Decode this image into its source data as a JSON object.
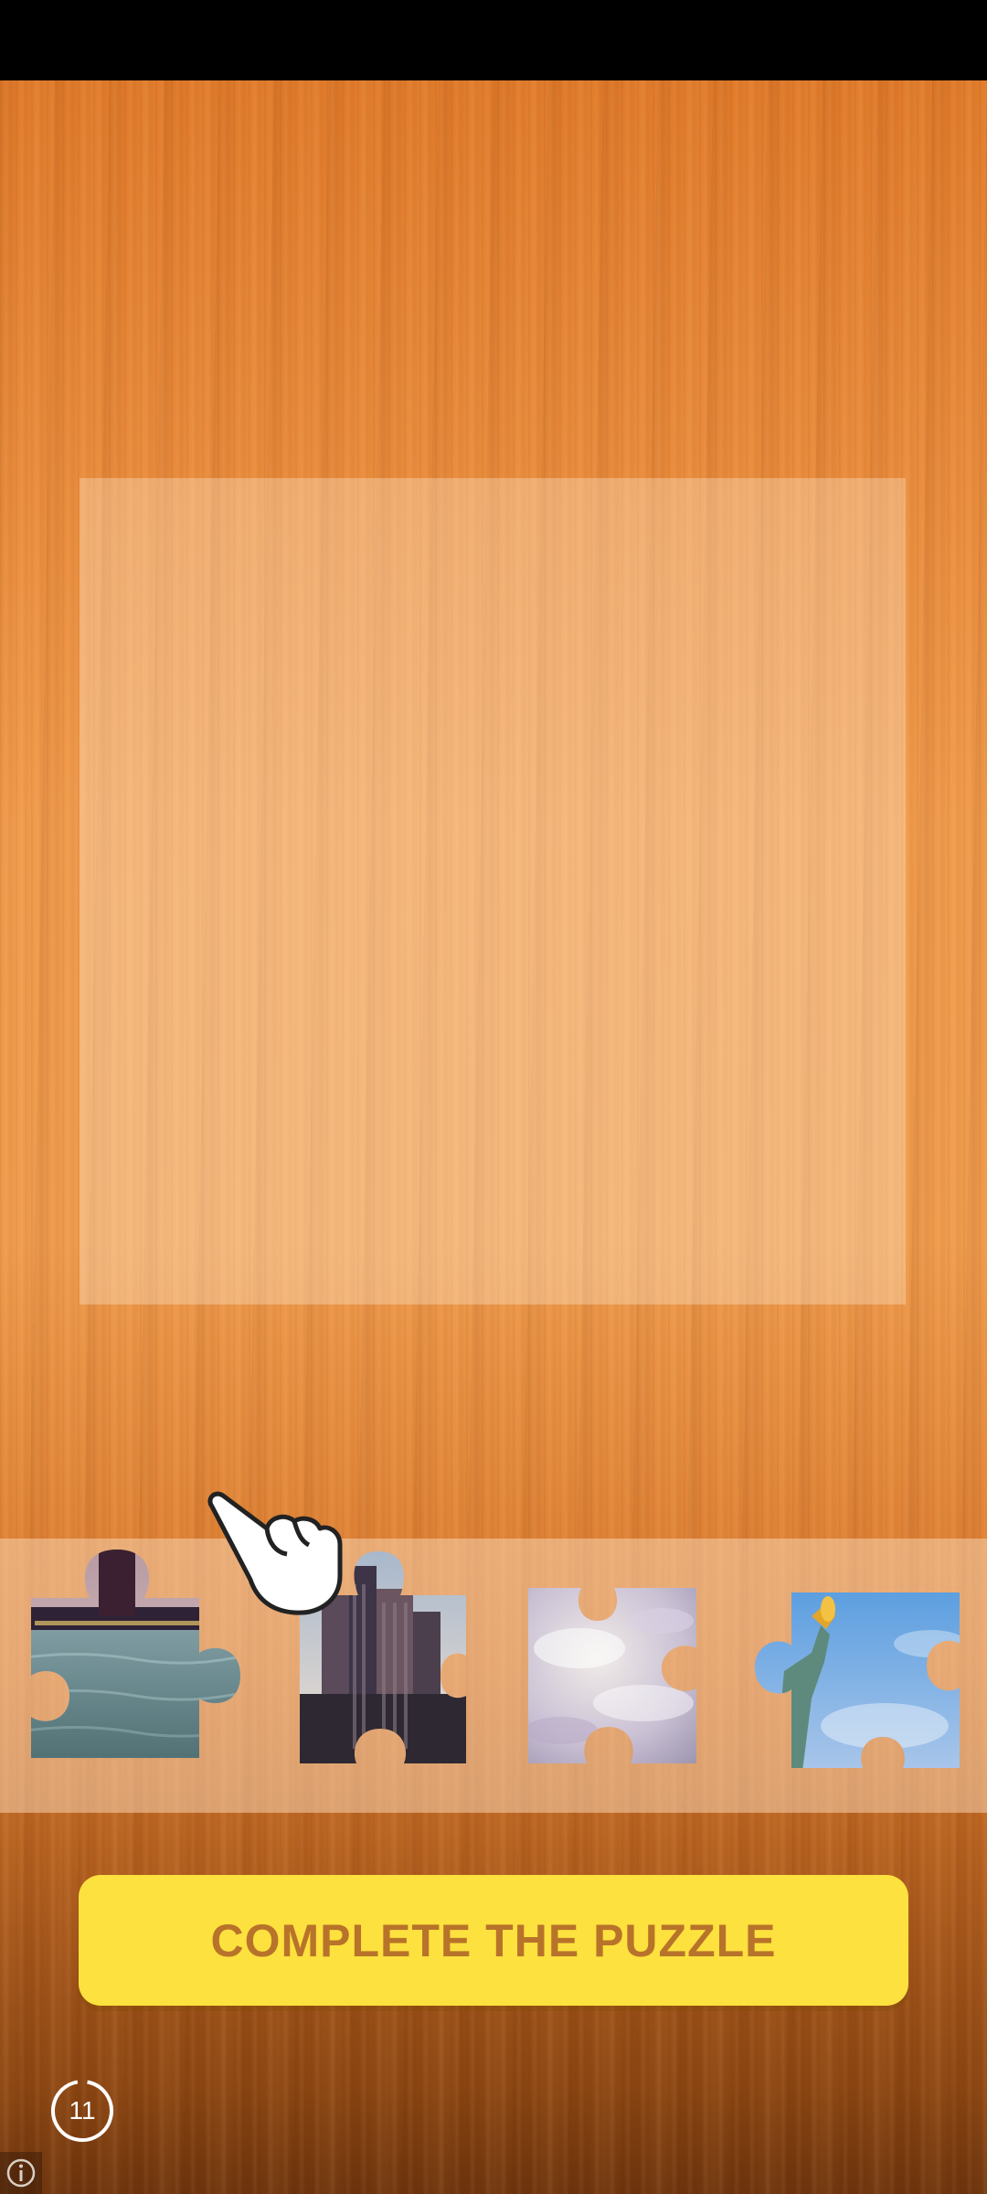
{
  "game": {
    "cta_label": "COMPLETE THE PUZZLE",
    "timer_value": "11"
  },
  "colors": {
    "cta_bg": "#fde13e",
    "cta_text": "#b8732a",
    "wood": "#ef9b4d"
  },
  "tray": {
    "pieces": [
      {
        "name": "piece-skyline-water"
      },
      {
        "name": "piece-buildings"
      },
      {
        "name": "piece-clouds"
      },
      {
        "name": "piece-statue-of-liberty"
      }
    ]
  },
  "icons": [
    "pointing-hand-icon",
    "timer-ring-icon",
    "info-icon"
  ]
}
